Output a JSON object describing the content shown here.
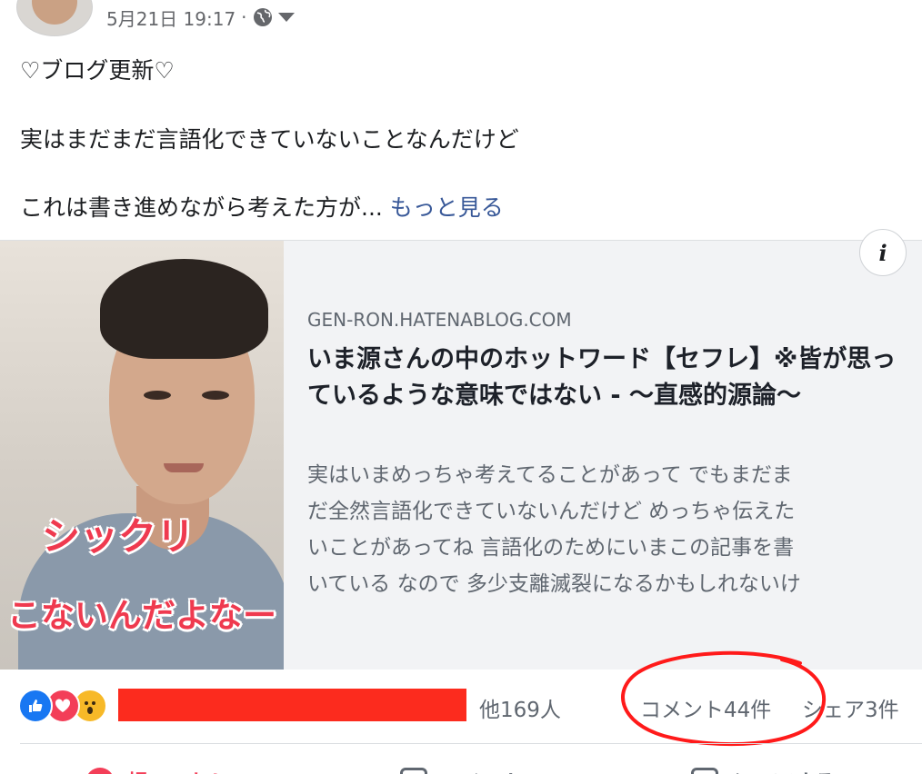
{
  "post": {
    "timestamp": "5月21日 19:17",
    "separator": "·",
    "privacy_icon": "globe-icon",
    "dropdown_icon": "caret-down-icon",
    "line1": "♡ブログ更新♡",
    "line2": "実はまだまだ言語化できていないことなんだけど",
    "line3": "これは書き進めながら考えた方が...",
    "see_more": "もっと見る"
  },
  "link_card": {
    "overlay_text_1": "シックリ",
    "overlay_text_2": "こないんだよなー",
    "info_label": "i",
    "domain": "GEN-RON.HATENABLOG.COM",
    "title": "いま源さんの中のホットワード【セフレ】※皆が思っているような意味ではない - 〜直感的源論〜",
    "description_lines": [
      "実はいまめっちゃ考えてることがあって でもまだま",
      "だ全然言語化できていないんだけど めっちゃ伝えた",
      "いことがあってね 言語化のためにいまこの記事を書",
      "いている なので 多少支離滅裂になるかもしれないけ"
    ]
  },
  "stats": {
    "reaction_icons": [
      "like-icon",
      "love-icon",
      "wow-icon"
    ],
    "others_count": "他169人",
    "comments": "コメント44件",
    "shares": "シェア3件"
  },
  "actions": {
    "like": "超いいね！",
    "comment": "コメント",
    "share": "シェアする"
  },
  "colors": {
    "link": "#385898",
    "muted": "#65676b",
    "redaction": "#fc2b1e",
    "annotation": "#ff1a1a",
    "like_blue": "#1877f2",
    "love_red": "#f33e58",
    "wow_yellow": "#f7b928"
  }
}
